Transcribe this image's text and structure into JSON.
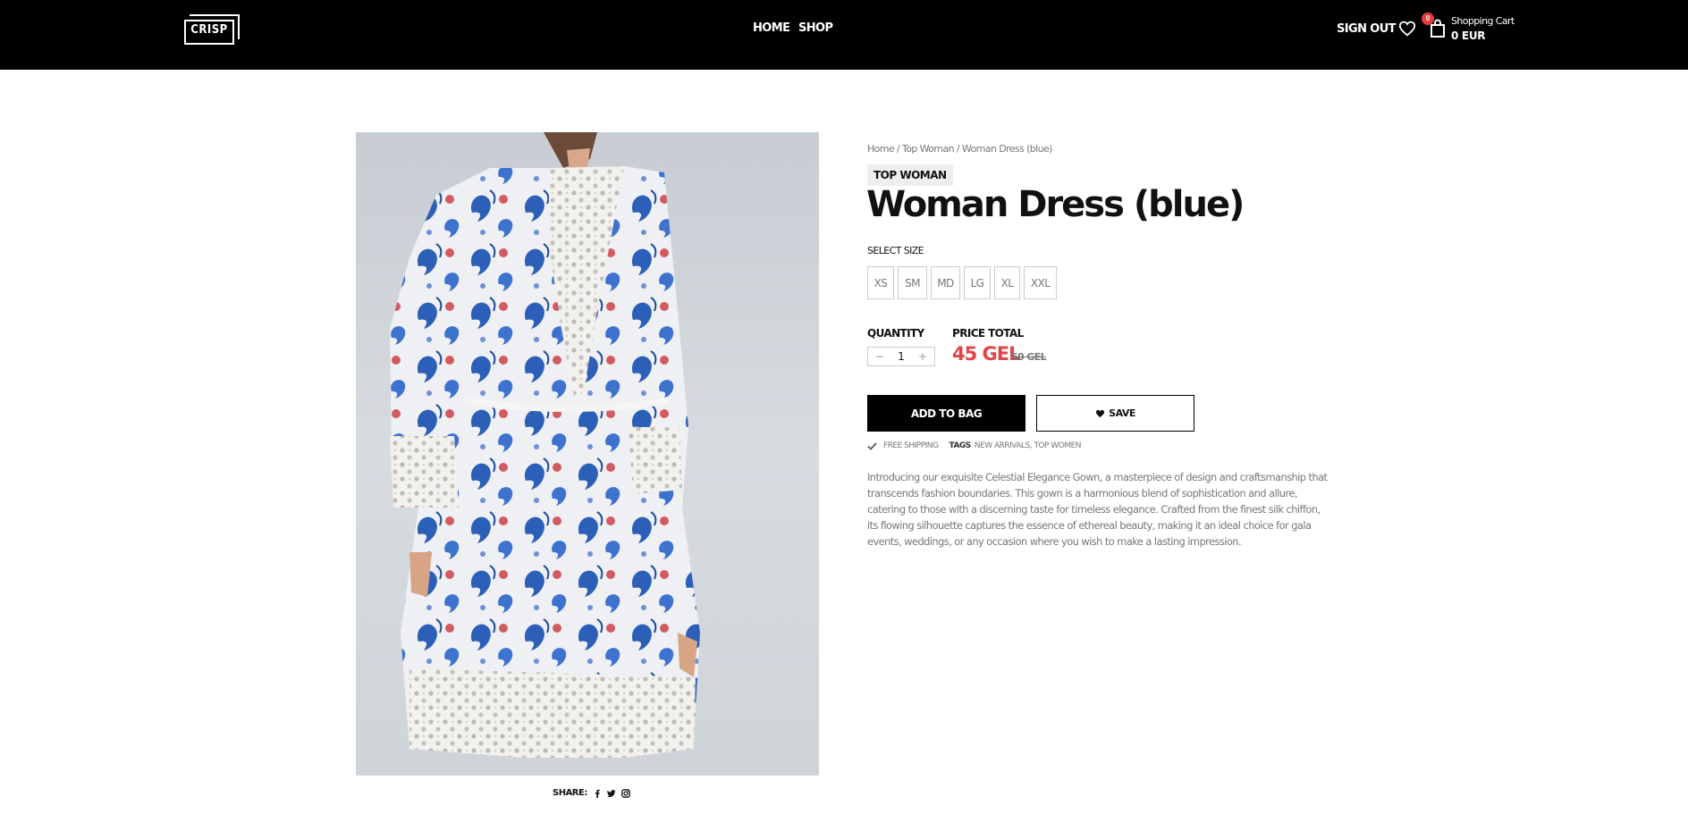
{
  "header": {
    "logo_text": "CRISP",
    "nav": {
      "home": "HOME",
      "shop": "SHOP"
    },
    "signout": "SIGN OUT",
    "cart": {
      "badge_count": "0",
      "title": "Shopping Cart",
      "total": "0 EUR"
    },
    "icons": {
      "wishlist": "heart-icon",
      "cart": "shopping-bag-icon"
    }
  },
  "product": {
    "breadcrumb": "Home / Top Woman / Woman Dress (blue)",
    "category": "TOP WOMAN",
    "title": "Woman Dress (blue)",
    "select_size_label": "SELECT SIZE",
    "sizes": [
      "XS",
      "SM",
      "MD",
      "LG",
      "XL",
      "XXL"
    ],
    "quantity_label": "QUANTITY",
    "quantity": "1",
    "price_total_label": "PRICE TOTAL",
    "price": "45 GEL",
    "old_price": "50 GEL",
    "add_to_bag": "ADD TO BAG",
    "save": "SAVE",
    "free_shipping": "FREE SHIPPING",
    "tags_label": "TAGS",
    "tags": "NEW ARRIVALS, TOP WOMEN",
    "description": "Introducing our exquisite Celestial Elegance Gown, a masterpiece of design and craftsmanship that transcends fashion boundaries. This gown is a harmonious blend of sophistication and allure, catering to those with a discerning taste for timeless elegance. Crafted from the finest silk chiffon, its flowing silhouette captures the essence of ethereal beauty, making it an ideal choice for gala events, weddings, or any occasion where you wish to make a lasting impression.",
    "share_label": "SHARE:",
    "share_icons": [
      "facebook-icon",
      "twitter-icon",
      "instagram-icon"
    ],
    "accent_color": "#e0454a"
  }
}
